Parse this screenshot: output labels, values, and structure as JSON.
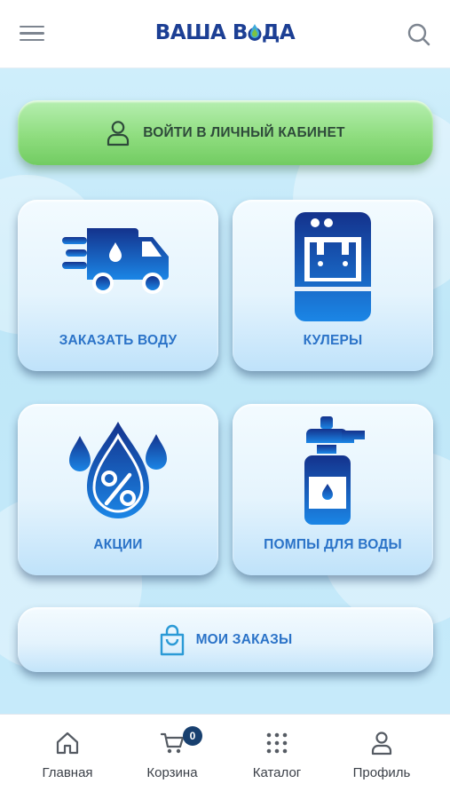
{
  "header": {
    "logo_text": "ВАША ВОДА",
    "logo_left": "ВАША В",
    "logo_right": "ДА",
    "menu_icon": "hamburger-menu-icon",
    "search_icon": "search-icon"
  },
  "main": {
    "login_button": {
      "label": "ВОЙТИ В ЛИЧНЫЙ КАБИНЕТ",
      "icon": "user-icon"
    },
    "tiles": [
      {
        "label": "ЗАКАЗАТЬ ВОДУ",
        "icon": "delivery-truck-icon"
      },
      {
        "label": "КУЛЕРЫ",
        "icon": "water-cooler-icon"
      },
      {
        "label": "АКЦИИ",
        "icon": "percent-drop-icon"
      },
      {
        "label": "ПОМПЫ ДЛЯ ВОДЫ",
        "icon": "water-pump-icon"
      }
    ],
    "orders_button": {
      "label": "МОИ ЗАКАЗЫ",
      "icon": "shopping-bag-icon"
    }
  },
  "tabbar": {
    "items": [
      {
        "label": "Главная",
        "icon": "home-icon"
      },
      {
        "label": "Корзина",
        "icon": "cart-icon",
        "badge": "0"
      },
      {
        "label": "Каталог",
        "icon": "grid-dots-icon"
      },
      {
        "label": "Профиль",
        "icon": "profile-icon"
      }
    ]
  },
  "colors": {
    "brand": "#1c3f94",
    "accent_blue": "#2b73c8",
    "login_green": "#8fdd7f",
    "background": "#c6eafa",
    "badge": "#18406f"
  }
}
